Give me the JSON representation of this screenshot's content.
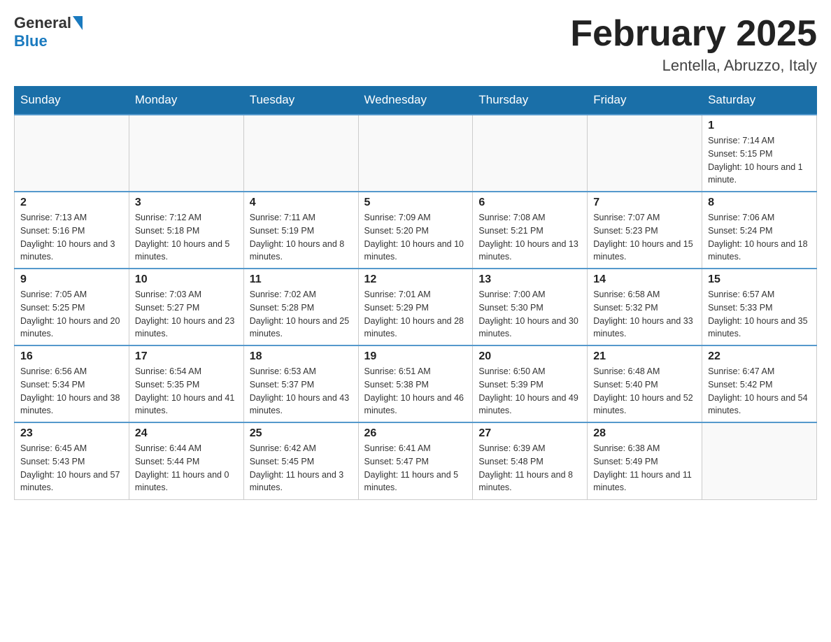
{
  "logo": {
    "text_general": "General",
    "text_blue": "Blue"
  },
  "header": {
    "month_title": "February 2025",
    "location": "Lentella, Abruzzo, Italy"
  },
  "weekdays": [
    "Sunday",
    "Monday",
    "Tuesday",
    "Wednesday",
    "Thursday",
    "Friday",
    "Saturday"
  ],
  "weeks": [
    [
      {
        "day": "",
        "sunrise": "",
        "sunset": "",
        "daylight": "",
        "empty": true
      },
      {
        "day": "",
        "sunrise": "",
        "sunset": "",
        "daylight": "",
        "empty": true
      },
      {
        "day": "",
        "sunrise": "",
        "sunset": "",
        "daylight": "",
        "empty": true
      },
      {
        "day": "",
        "sunrise": "",
        "sunset": "",
        "daylight": "",
        "empty": true
      },
      {
        "day": "",
        "sunrise": "",
        "sunset": "",
        "daylight": "",
        "empty": true
      },
      {
        "day": "",
        "sunrise": "",
        "sunset": "",
        "daylight": "",
        "empty": true
      },
      {
        "day": "1",
        "sunrise": "Sunrise: 7:14 AM",
        "sunset": "Sunset: 5:15 PM",
        "daylight": "Daylight: 10 hours and 1 minute.",
        "empty": false
      }
    ],
    [
      {
        "day": "2",
        "sunrise": "Sunrise: 7:13 AM",
        "sunset": "Sunset: 5:16 PM",
        "daylight": "Daylight: 10 hours and 3 minutes.",
        "empty": false
      },
      {
        "day": "3",
        "sunrise": "Sunrise: 7:12 AM",
        "sunset": "Sunset: 5:18 PM",
        "daylight": "Daylight: 10 hours and 5 minutes.",
        "empty": false
      },
      {
        "day": "4",
        "sunrise": "Sunrise: 7:11 AM",
        "sunset": "Sunset: 5:19 PM",
        "daylight": "Daylight: 10 hours and 8 minutes.",
        "empty": false
      },
      {
        "day": "5",
        "sunrise": "Sunrise: 7:09 AM",
        "sunset": "Sunset: 5:20 PM",
        "daylight": "Daylight: 10 hours and 10 minutes.",
        "empty": false
      },
      {
        "day": "6",
        "sunrise": "Sunrise: 7:08 AM",
        "sunset": "Sunset: 5:21 PM",
        "daylight": "Daylight: 10 hours and 13 minutes.",
        "empty": false
      },
      {
        "day": "7",
        "sunrise": "Sunrise: 7:07 AM",
        "sunset": "Sunset: 5:23 PM",
        "daylight": "Daylight: 10 hours and 15 minutes.",
        "empty": false
      },
      {
        "day": "8",
        "sunrise": "Sunrise: 7:06 AM",
        "sunset": "Sunset: 5:24 PM",
        "daylight": "Daylight: 10 hours and 18 minutes.",
        "empty": false
      }
    ],
    [
      {
        "day": "9",
        "sunrise": "Sunrise: 7:05 AM",
        "sunset": "Sunset: 5:25 PM",
        "daylight": "Daylight: 10 hours and 20 minutes.",
        "empty": false
      },
      {
        "day": "10",
        "sunrise": "Sunrise: 7:03 AM",
        "sunset": "Sunset: 5:27 PM",
        "daylight": "Daylight: 10 hours and 23 minutes.",
        "empty": false
      },
      {
        "day": "11",
        "sunrise": "Sunrise: 7:02 AM",
        "sunset": "Sunset: 5:28 PM",
        "daylight": "Daylight: 10 hours and 25 minutes.",
        "empty": false
      },
      {
        "day": "12",
        "sunrise": "Sunrise: 7:01 AM",
        "sunset": "Sunset: 5:29 PM",
        "daylight": "Daylight: 10 hours and 28 minutes.",
        "empty": false
      },
      {
        "day": "13",
        "sunrise": "Sunrise: 7:00 AM",
        "sunset": "Sunset: 5:30 PM",
        "daylight": "Daylight: 10 hours and 30 minutes.",
        "empty": false
      },
      {
        "day": "14",
        "sunrise": "Sunrise: 6:58 AM",
        "sunset": "Sunset: 5:32 PM",
        "daylight": "Daylight: 10 hours and 33 minutes.",
        "empty": false
      },
      {
        "day": "15",
        "sunrise": "Sunrise: 6:57 AM",
        "sunset": "Sunset: 5:33 PM",
        "daylight": "Daylight: 10 hours and 35 minutes.",
        "empty": false
      }
    ],
    [
      {
        "day": "16",
        "sunrise": "Sunrise: 6:56 AM",
        "sunset": "Sunset: 5:34 PM",
        "daylight": "Daylight: 10 hours and 38 minutes.",
        "empty": false
      },
      {
        "day": "17",
        "sunrise": "Sunrise: 6:54 AM",
        "sunset": "Sunset: 5:35 PM",
        "daylight": "Daylight: 10 hours and 41 minutes.",
        "empty": false
      },
      {
        "day": "18",
        "sunrise": "Sunrise: 6:53 AM",
        "sunset": "Sunset: 5:37 PM",
        "daylight": "Daylight: 10 hours and 43 minutes.",
        "empty": false
      },
      {
        "day": "19",
        "sunrise": "Sunrise: 6:51 AM",
        "sunset": "Sunset: 5:38 PM",
        "daylight": "Daylight: 10 hours and 46 minutes.",
        "empty": false
      },
      {
        "day": "20",
        "sunrise": "Sunrise: 6:50 AM",
        "sunset": "Sunset: 5:39 PM",
        "daylight": "Daylight: 10 hours and 49 minutes.",
        "empty": false
      },
      {
        "day": "21",
        "sunrise": "Sunrise: 6:48 AM",
        "sunset": "Sunset: 5:40 PM",
        "daylight": "Daylight: 10 hours and 52 minutes.",
        "empty": false
      },
      {
        "day": "22",
        "sunrise": "Sunrise: 6:47 AM",
        "sunset": "Sunset: 5:42 PM",
        "daylight": "Daylight: 10 hours and 54 minutes.",
        "empty": false
      }
    ],
    [
      {
        "day": "23",
        "sunrise": "Sunrise: 6:45 AM",
        "sunset": "Sunset: 5:43 PM",
        "daylight": "Daylight: 10 hours and 57 minutes.",
        "empty": false
      },
      {
        "day": "24",
        "sunrise": "Sunrise: 6:44 AM",
        "sunset": "Sunset: 5:44 PM",
        "daylight": "Daylight: 11 hours and 0 minutes.",
        "empty": false
      },
      {
        "day": "25",
        "sunrise": "Sunrise: 6:42 AM",
        "sunset": "Sunset: 5:45 PM",
        "daylight": "Daylight: 11 hours and 3 minutes.",
        "empty": false
      },
      {
        "day": "26",
        "sunrise": "Sunrise: 6:41 AM",
        "sunset": "Sunset: 5:47 PM",
        "daylight": "Daylight: 11 hours and 5 minutes.",
        "empty": false
      },
      {
        "day": "27",
        "sunrise": "Sunrise: 6:39 AM",
        "sunset": "Sunset: 5:48 PM",
        "daylight": "Daylight: 11 hours and 8 minutes.",
        "empty": false
      },
      {
        "day": "28",
        "sunrise": "Sunrise: 6:38 AM",
        "sunset": "Sunset: 5:49 PM",
        "daylight": "Daylight: 11 hours and 11 minutes.",
        "empty": false
      },
      {
        "day": "",
        "sunrise": "",
        "sunset": "",
        "daylight": "",
        "empty": true
      }
    ]
  ]
}
